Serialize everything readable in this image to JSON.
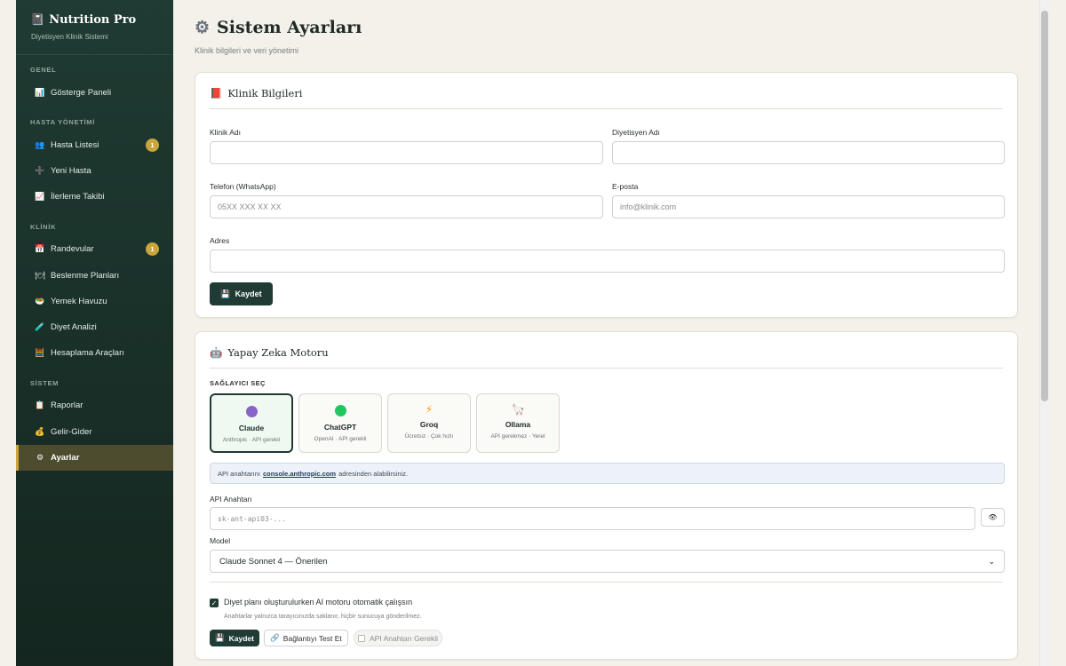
{
  "brand": {
    "icon": "📓",
    "title": "Nutrition Pro",
    "subtitle": "Diyetisyen Klinik Sistemi"
  },
  "sidebar": {
    "sections": [
      {
        "label": "GENEL"
      },
      {
        "label": "HASTA YÖNETİMİ"
      },
      {
        "label": "KLİNİK"
      },
      {
        "label": "SİSTEM"
      }
    ],
    "items": [
      {
        "icon": "📊",
        "label": "Gösterge Paneli"
      },
      {
        "icon": "👥",
        "label": "Hasta Listesi",
        "badge": "1"
      },
      {
        "icon": "➕",
        "label": "Yeni Hasta"
      },
      {
        "icon": "📈",
        "label": "İlerleme Takibi"
      },
      {
        "icon": "📅",
        "label": "Randevular",
        "badge": "1"
      },
      {
        "icon": "🍽",
        "label": "Beslenme Planları"
      },
      {
        "icon": "🥗",
        "label": "Yemek Havuzu"
      },
      {
        "icon": "🧪",
        "label": "Diyet Analizi"
      },
      {
        "icon": "🧮",
        "label": "Hesaplama Araçları"
      },
      {
        "icon": "📋",
        "label": "Raporlar"
      },
      {
        "icon": "💰",
        "label": "Gelir-Gider"
      },
      {
        "icon": "⚙",
        "label": "Ayarlar",
        "active": true
      }
    ]
  },
  "page": {
    "icon": "⚙",
    "title": "Sistem Ayarları",
    "subtitle": "Klinik bilgileri ve veri yönetimi"
  },
  "clinic": {
    "icon": "📕",
    "title": "Klinik Bilgileri",
    "fields": {
      "clinic_name": {
        "label": "Klinik Adı",
        "value": "",
        "placeholder": ""
      },
      "dietitian_name": {
        "label": "Diyetisyen Adı",
        "value": "",
        "placeholder": ""
      },
      "phone": {
        "label": "Telefon (WhatsApp)",
        "value": "",
        "placeholder": "05XX XXX XX XX"
      },
      "email": {
        "label": "E-posta",
        "value": "",
        "placeholder": "info@klinik.com"
      },
      "address": {
        "label": "Adres",
        "value": "",
        "placeholder": ""
      }
    },
    "save_icon": "💾",
    "save_label": "Kaydet"
  },
  "ai": {
    "icon": "🤖",
    "title": "Yapay Zeka Motoru",
    "provider_label": "SAĞLAYICI SEÇ",
    "providers": [
      {
        "name": "Claude",
        "desc": "Anthropic · API gerekli",
        "icon_color": "#8a63c9",
        "selected": true
      },
      {
        "name": "ChatGPT",
        "desc": "OpenAI · API gerekli",
        "icon_color": "#22c55e"
      },
      {
        "name": "Groq",
        "desc": "Ücretsiz · Çok hızlı",
        "icon": "⚡",
        "icon_color": "#f59e0b"
      },
      {
        "name": "Ollama",
        "desc": "API gerekmez · Yerel",
        "icon": "🦙",
        "icon_color": "#9ca3af"
      }
    ],
    "info_before": "API anahtarını",
    "info_link": "console.anthropic.com",
    "info_after": "adresinden alabilirsiniz.",
    "api_key_label": "API Anahtarı",
    "api_key_value": "",
    "api_key_placeholder": "sk-ant-api03-...",
    "eye_icon": "👁",
    "model_label": "Model",
    "model_value": "Claude Sonnet 4 — Önerilen",
    "auto_checkbox_checked": true,
    "auto_label": "Diyet planı oluşturulurken AI motoru otomatik çalışsın",
    "storage_note": "Anahtarlar yalnızca tarayıcınızda saklanır, hiçbir sunucuya gönderilmez.",
    "save_icon": "💾",
    "save_label": "Kaydet",
    "test_icon": "🔗",
    "test_label": "Bağlantıyı Test Et",
    "status_label": "API Anahtarı Gerekli"
  }
}
